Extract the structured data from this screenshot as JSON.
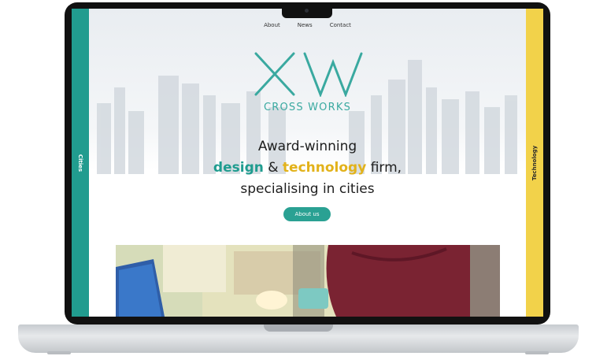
{
  "nav": {
    "items": [
      "About",
      "News",
      "Contact"
    ]
  },
  "logo": {
    "mark": "XW",
    "name": "CROSS WORKS"
  },
  "headline": {
    "line1": "Award-winning",
    "design": "design",
    "amp": "&",
    "technology": "technology",
    "firm": "firm,",
    "line3": "specialising in cities"
  },
  "cta": {
    "label": "About us"
  },
  "sidebars": {
    "left": "Cities",
    "right": "Technology"
  },
  "colors": {
    "teal": "#219c8f",
    "yellow": "#f2d24a",
    "gold_text": "#e2b21a"
  }
}
